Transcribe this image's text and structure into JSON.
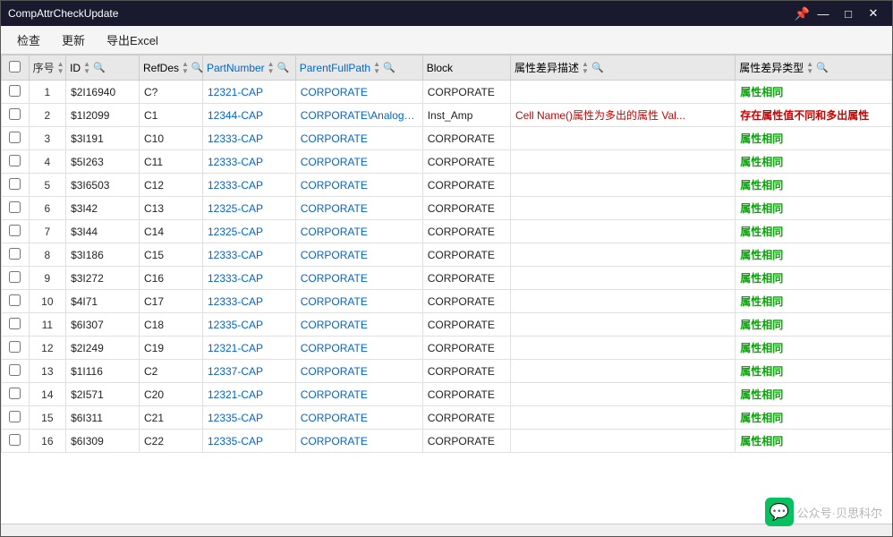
{
  "window": {
    "title": "CompAttrCheckUpdate",
    "pin_label": "📌",
    "minimize_label": "—",
    "maximize_label": "□",
    "close_label": "✕"
  },
  "menu": {
    "items": [
      "检查",
      "更新",
      "导出Excel"
    ]
  },
  "table": {
    "columns": [
      {
        "id": "check",
        "label": ""
      },
      {
        "id": "seq",
        "label": "序号"
      },
      {
        "id": "id",
        "label": "ID"
      },
      {
        "id": "refdes",
        "label": "RefDes"
      },
      {
        "id": "partnum",
        "label": "PartNumber"
      },
      {
        "id": "parentfull",
        "label": "ParentFullPath"
      },
      {
        "id": "block",
        "label": "Block"
      },
      {
        "id": "attrdiff",
        "label": "属性差异描述"
      },
      {
        "id": "attrtype",
        "label": "属性差异类型"
      }
    ],
    "rows": [
      {
        "seq": "1",
        "id": "$2I16940",
        "refdes": "C?",
        "partnum": "12321-CAP",
        "parentfull": "CORPORATE",
        "block": "CORPORATE",
        "attrdiff": "",
        "attrtype": "属性相同",
        "attrtype_class": "status-same"
      },
      {
        "seq": "2",
        "id": "$1I2099",
        "refdes": "C1",
        "partnum": "12344-CAP",
        "parentfull": "CORPORATE\\Analog_...",
        "block": "Inst_Amp",
        "attrdiff": "Cell Name()属性为多出的属性 Val...",
        "attrtype": "存在属性值不同和多出属性",
        "attrtype_class": "status-diff"
      },
      {
        "seq": "3",
        "id": "$3I191",
        "refdes": "C10",
        "partnum": "12333-CAP",
        "parentfull": "CORPORATE",
        "block": "CORPORATE",
        "attrdiff": "",
        "attrtype": "属性相同",
        "attrtype_class": "status-same"
      },
      {
        "seq": "4",
        "id": "$5I263",
        "refdes": "C11",
        "partnum": "12333-CAP",
        "parentfull": "CORPORATE",
        "block": "CORPORATE",
        "attrdiff": "",
        "attrtype": "属性相同",
        "attrtype_class": "status-same"
      },
      {
        "seq": "5",
        "id": "$3I6503",
        "refdes": "C12",
        "partnum": "12333-CAP",
        "parentfull": "CORPORATE",
        "block": "CORPORATE",
        "attrdiff": "",
        "attrtype": "属性相同",
        "attrtype_class": "status-same"
      },
      {
        "seq": "6",
        "id": "$3I42",
        "refdes": "C13",
        "partnum": "12325-CAP",
        "parentfull": "CORPORATE",
        "block": "CORPORATE",
        "attrdiff": "",
        "attrtype": "属性相同",
        "attrtype_class": "status-same"
      },
      {
        "seq": "7",
        "id": "$3I44",
        "refdes": "C14",
        "partnum": "12325-CAP",
        "parentfull": "CORPORATE",
        "block": "CORPORATE",
        "attrdiff": "",
        "attrtype": "属性相同",
        "attrtype_class": "status-same"
      },
      {
        "seq": "8",
        "id": "$3I186",
        "refdes": "C15",
        "partnum": "12333-CAP",
        "parentfull": "CORPORATE",
        "block": "CORPORATE",
        "attrdiff": "",
        "attrtype": "属性相同",
        "attrtype_class": "status-same"
      },
      {
        "seq": "9",
        "id": "$3I272",
        "refdes": "C16",
        "partnum": "12333-CAP",
        "parentfull": "CORPORATE",
        "block": "CORPORATE",
        "attrdiff": "",
        "attrtype": "属性相同",
        "attrtype_class": "status-same"
      },
      {
        "seq": "10",
        "id": "$4I71",
        "refdes": "C17",
        "partnum": "12333-CAP",
        "parentfull": "CORPORATE",
        "block": "CORPORATE",
        "attrdiff": "",
        "attrtype": "属性相同",
        "attrtype_class": "status-same"
      },
      {
        "seq": "11",
        "id": "$6I307",
        "refdes": "C18",
        "partnum": "12335-CAP",
        "parentfull": "CORPORATE",
        "block": "CORPORATE",
        "attrdiff": "",
        "attrtype": "属性相同",
        "attrtype_class": "status-same"
      },
      {
        "seq": "12",
        "id": "$2I249",
        "refdes": "C19",
        "partnum": "12321-CAP",
        "parentfull": "CORPORATE",
        "block": "CORPORATE",
        "attrdiff": "",
        "attrtype": "属性相同",
        "attrtype_class": "status-same"
      },
      {
        "seq": "13",
        "id": "$1I116",
        "refdes": "C2",
        "partnum": "12337-CAP",
        "parentfull": "CORPORATE",
        "block": "CORPORATE",
        "attrdiff": "",
        "attrtype": "属性相同",
        "attrtype_class": "status-same"
      },
      {
        "seq": "14",
        "id": "$2I571",
        "refdes": "C20",
        "partnum": "12321-CAP",
        "parentfull": "CORPORATE",
        "block": "CORPORATE",
        "attrdiff": "",
        "attrtype": "属性相同",
        "attrtype_class": "status-same"
      },
      {
        "seq": "15",
        "id": "$6I311",
        "refdes": "C21",
        "partnum": "12335-CAP",
        "parentfull": "CORPORATE",
        "block": "CORPORATE",
        "attrdiff": "",
        "attrtype": "属性相同",
        "attrtype_class": "status-same"
      },
      {
        "seq": "16",
        "id": "$6I309",
        "refdes": "C22",
        "partnum": "12335-CAP",
        "parentfull": "CORPORATE",
        "block": "CORPORATE",
        "attrdiff": "",
        "attrtype": "属性相同",
        "attrtype_class": "status-same"
      }
    ]
  },
  "watermark": {
    "text": "公众号·贝思科尔"
  }
}
